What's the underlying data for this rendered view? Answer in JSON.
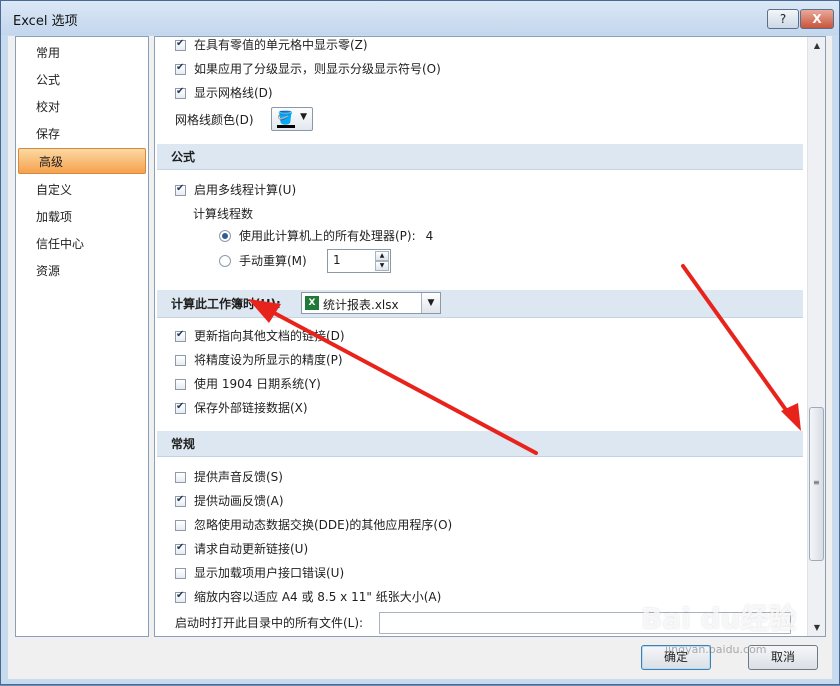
{
  "window": {
    "title": "Excel 选项",
    "help_label": "?",
    "close_label": "X"
  },
  "sidebar": {
    "items": [
      {
        "label": "常用"
      },
      {
        "label": "公式"
      },
      {
        "label": "校对"
      },
      {
        "label": "保存"
      },
      {
        "label": "高级",
        "selected": true
      },
      {
        "label": "自定义"
      },
      {
        "label": "加载项"
      },
      {
        "label": "信任中心"
      },
      {
        "label": "资源"
      }
    ]
  },
  "display_options": {
    "zero_values": {
      "label": "在具有零值的单元格中显示零(Z)",
      "checked": true
    },
    "outline_symbols": {
      "label": "如果应用了分级显示，则显示分级显示符号(O)",
      "checked": true
    },
    "gridlines": {
      "label": "显示网格线(D)",
      "checked": true
    },
    "gridline_color_label": "网格线颜色(D)"
  },
  "formulas": {
    "header": "公式",
    "multithread": {
      "label": "启用多线程计算(U)",
      "checked": true
    },
    "threads_label": "计算线程数",
    "all_processors": {
      "label": "使用此计算机上的所有处理器(P):",
      "value": "4",
      "selected": true
    },
    "manual": {
      "label": "手动重算(M)",
      "value": "1",
      "selected": false
    }
  },
  "workbook_calc": {
    "header": "计算此工作簿时(H):",
    "workbook": "统计报表.xlsx",
    "icon_letter": "X",
    "update_links": {
      "label": "更新指向其他文档的链接(D)",
      "checked": true
    },
    "precision": {
      "label": "将精度设为所显示的精度(P)",
      "checked": false
    },
    "date1904": {
      "label": "使用 1904 日期系统(Y)",
      "checked": false
    },
    "save_external": {
      "label": "保存外部链接数据(X)",
      "checked": true
    }
  },
  "general": {
    "header": "常规",
    "sound": {
      "label": "提供声音反馈(S)",
      "checked": false
    },
    "animation": {
      "label": "提供动画反馈(A)",
      "checked": true
    },
    "ignore_dde": {
      "label": "忽略使用动态数据交换(DDE)的其他应用程序(O)",
      "checked": false
    },
    "auto_update": {
      "label": "请求自动更新链接(U)",
      "checked": true
    },
    "addin_errors": {
      "label": "显示加载项用户接口错误(U)",
      "checked": false
    },
    "scale_paper": {
      "label": "缩放内容以适应 A4 或 8.5 x 11\" 纸张大小(A)",
      "checked": true
    },
    "startup_label": "启动时打开此目录中的所有文件(L):",
    "startup_value": ""
  },
  "footer": {
    "ok_label": "确定",
    "cancel_label": "取消"
  },
  "watermark": {
    "text": "Bai du经验",
    "sub": "jingyan.baidu.com"
  },
  "colors": {
    "annotation_arrow": "#e8231b",
    "selected_item": "#f6a14d",
    "section_bg": "#dde7f1"
  }
}
